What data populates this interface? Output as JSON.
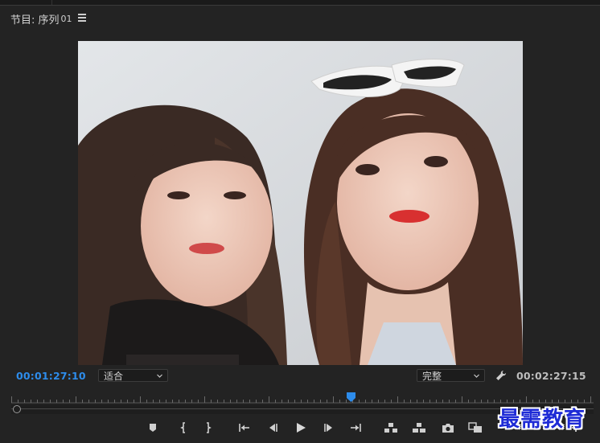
{
  "panel": {
    "title": "节目: 序列",
    "sequence_number": "01",
    "menu_icon": "hamburger-menu-icon"
  },
  "viewer": {
    "content": "video-frame"
  },
  "timecode": {
    "current": "00:01:27:10",
    "duration": "00:02:27:15",
    "current_color": "#2d8ceb"
  },
  "zoom_select": {
    "value": "适合"
  },
  "quality_select": {
    "value": "完整"
  },
  "playhead": {
    "position_fraction": 0.58,
    "color": "#2d8ceb"
  },
  "controls": [
    {
      "name": "add-marker-button",
      "icon": "marker-icon"
    },
    {
      "name": "mark-in-button",
      "icon": "mark-in-icon"
    },
    {
      "name": "mark-out-button",
      "icon": "mark-out-icon"
    },
    {
      "name": "go-to-in-button",
      "icon": "go-to-in-icon"
    },
    {
      "name": "step-back-button",
      "icon": "step-back-icon"
    },
    {
      "name": "play-button",
      "icon": "play-icon"
    },
    {
      "name": "step-forward-button",
      "icon": "step-forward-icon"
    },
    {
      "name": "go-to-out-button",
      "icon": "go-to-out-icon"
    },
    {
      "name": "lift-button",
      "icon": "lift-icon"
    },
    {
      "name": "extract-button",
      "icon": "extract-icon"
    },
    {
      "name": "export-frame-button",
      "icon": "camera-icon"
    },
    {
      "name": "compare-view-button",
      "icon": "comparison-icon"
    },
    {
      "name": "button-editor-button",
      "icon": "plus-icon"
    }
  ],
  "watermark": {
    "text": "最需教育",
    "color": "#1e2bd6"
  }
}
